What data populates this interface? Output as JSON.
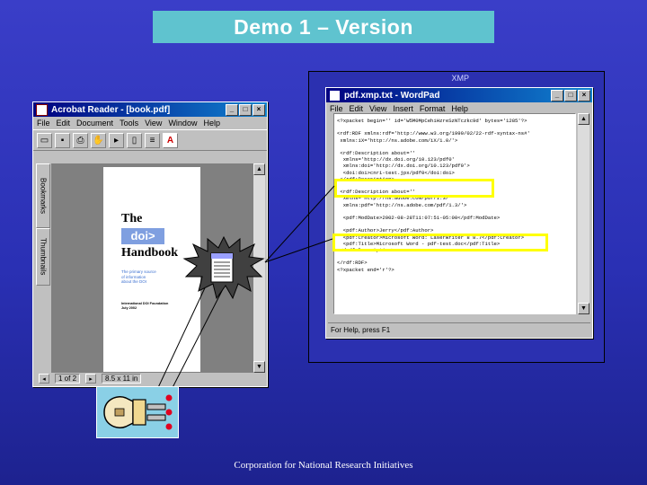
{
  "slide": {
    "title": "Demo 1 – Version",
    "footer": "Corporation for National Research Initiatives",
    "xmp_label": "XMP"
  },
  "acrobat": {
    "title": "Acrobat Reader - [book.pdf]",
    "menus": [
      "File",
      "Edit",
      "Document",
      "Tools",
      "View",
      "Window",
      "Help"
    ],
    "side_tabs": [
      "Bookmarks",
      "Thumbnails"
    ],
    "book": {
      "title_line1": "The",
      "title_line2": "doi>",
      "title_line3": "Handbook",
      "blurb": "The primary source\nof information\nabout the DOI",
      "publisher": "International DOI Foundation\nJuly 2002"
    },
    "status_page": "1 of 2",
    "status_size": "8.5 x 11 in"
  },
  "wordpad": {
    "title": "pdf.xmp.txt - WordPad",
    "menus": [
      "File",
      "Edit",
      "View",
      "Insert",
      "Format",
      "Help"
    ],
    "lines": [
      "<?xpacket begin='' id='W5M0MpCehiHzreSzNTczkc9d' bytes='1285'?>",
      "",
      "<rdf:RDF xmlns:rdf='http://www.w3.org/1999/02/22-rdf-syntax-ns#'",
      " xmlns:iX='http://ns.adobe.com/iX/1.0/'>",
      "",
      " <rdf:Description about=''",
      "  xmlns='http://dx.doi.org/10.123/pdf0'",
      "  xmlns:doi='http://dx.doi.org/10.123/pdf0'>",
      "  <doi:doi>cnri-test.jpx/pdf0</doi:doi>",
      " </rdf:Description>",
      "",
      " <rdf:Description about=''",
      "  xmlns='http://ns.adobe.com/pdf/1.3/'",
      "  xmlns:pdf='http://ns.adobe.com/pdf/1.3/'>",
      "",
      "  <pdf:ModDate>2002-08-28T11:07:51-05:00</pdf:ModDate>",
      "",
      "  <pdf:Author>Jerry</pdf:Author>",
      "  <pdf:Creator>Microsoft Word: LaserWriter 8 8.7</pdf:Creator>",
      "  <pdf:Title>Microsoft Word - pdf-test.doc</pdf:Title>",
      " </rdf:Description>",
      "",
      "</rdf:RDF>",
      "<?xpacket end='r'?>"
    ],
    "status": "For Help, press F1"
  },
  "colors": {
    "highlight": "#ffff00",
    "doi_blue": "#7f9fe0",
    "title_box": "#5fc3cf"
  }
}
